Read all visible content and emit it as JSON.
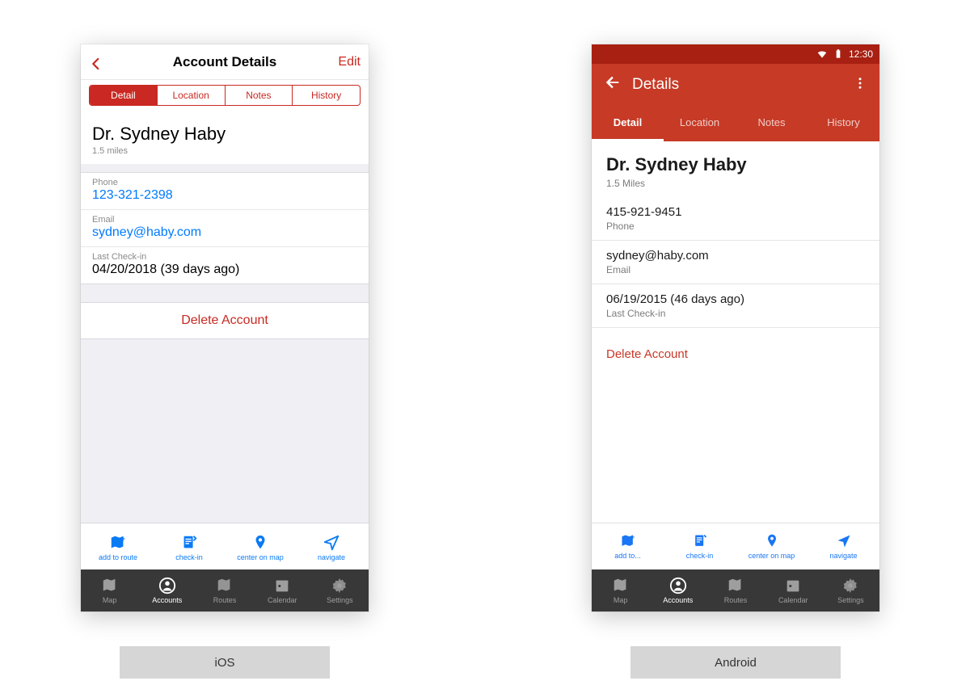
{
  "ios": {
    "nav": {
      "title": "Account Details",
      "edit": "Edit"
    },
    "segments": [
      "Detail",
      "Location",
      "Notes",
      "History"
    ],
    "active_segment": 0,
    "account": {
      "name": "Dr. Sydney Haby",
      "distance": "1.5 miles"
    },
    "fields": [
      {
        "label": "Phone",
        "value": "123-321-2398",
        "link": true
      },
      {
        "label": "Email",
        "value": "sydney@haby.com",
        "link": true
      },
      {
        "label": "Last Check-in",
        "value": "04/20/2018 (39 days ago)",
        "link": false
      }
    ],
    "delete": "Delete Account",
    "actions": [
      "add to route",
      "check-in",
      "center on map",
      "navigate"
    ],
    "tabs": [
      "Map",
      "Accounts",
      "Routes",
      "Calendar",
      "Settings"
    ],
    "active_tab": 1,
    "caption": "iOS"
  },
  "android": {
    "status": {
      "time": "12:30"
    },
    "nav": {
      "title": "Details"
    },
    "segments": [
      "Detail",
      "Location",
      "Notes",
      "History"
    ],
    "active_segment": 0,
    "account": {
      "name": "Dr. Sydney Haby",
      "distance": "1.5 Miles"
    },
    "fields": [
      {
        "value": "415-921-9451",
        "label": "Phone"
      },
      {
        "value": "sydney@haby.com",
        "label": "Email"
      },
      {
        "value": "06/19/2015 (46 days ago)",
        "label": "Last Check-in"
      }
    ],
    "delete": "Delete Account",
    "actions": [
      "add to...",
      "check-in",
      "center on map",
      "navigate"
    ],
    "tabs": [
      "Map",
      "Accounts",
      "Routes",
      "Calendar",
      "Settings"
    ],
    "active_tab": 1,
    "caption": "Android"
  }
}
